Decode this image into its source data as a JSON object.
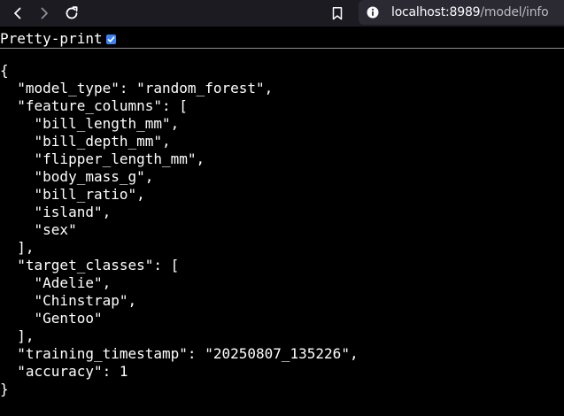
{
  "browser": {
    "url_host": "localhost:8989",
    "url_path": "/model/info",
    "back_icon": "chevron-left-icon",
    "forward_icon": "chevron-right-icon",
    "reload_icon": "reload-icon",
    "bookmark_icon": "bookmark-icon",
    "site_info_icon": "info-icon"
  },
  "pretty_print": {
    "label": "Pretty-print",
    "checked": true
  },
  "json_lines": [
    "{",
    "  \"model_type\": \"random_forest\",",
    "  \"feature_columns\": [",
    "    \"bill_length_mm\",",
    "    \"bill_depth_mm\",",
    "    \"flipper_length_mm\",",
    "    \"body_mass_g\",",
    "    \"bill_ratio\",",
    "    \"island\",",
    "    \"sex\"",
    "  ],",
    "  \"target_classes\": [",
    "    \"Adelie\",",
    "    \"Chinstrap\",",
    "    \"Gentoo\"",
    "  ],",
    "  \"training_timestamp\": \"20250807_135226\",",
    "  \"accuracy\": 1",
    "}"
  ],
  "colors": {
    "toolbar_bg": "#1c1b22",
    "urlbar_bg": "#2b2a33",
    "page_bg": "#000000",
    "text": "#ffffff",
    "checkbox_accent": "#3b82f6"
  }
}
